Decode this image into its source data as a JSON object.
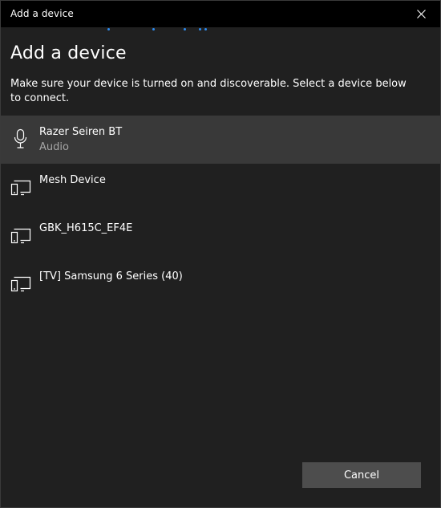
{
  "window": {
    "title": "Add a device",
    "close_icon": "close-icon"
  },
  "progress": {
    "color": "#2e8cf0",
    "indeterminate": true
  },
  "content": {
    "heading": "Add a device",
    "description": "Make sure your device is turned on and discoverable. Select a device below to connect."
  },
  "devices": [
    {
      "name": "Razer Seiren BT",
      "type": "Audio",
      "icon": "microphone-icon",
      "selected": true
    },
    {
      "name": "Mesh Device",
      "type": "",
      "icon": "display-device-icon",
      "selected": false
    },
    {
      "name": "GBK_H615C_EF4E",
      "type": "",
      "icon": "display-device-icon",
      "selected": false
    },
    {
      "name": "[TV] Samsung 6 Series (40)",
      "type": "",
      "icon": "display-device-icon",
      "selected": false
    }
  ],
  "footer": {
    "cancel_label": "Cancel"
  },
  "colors": {
    "background": "#202020",
    "titlebar": "#000000",
    "selected_row": "#393939",
    "secondary_text": "#a6a6a6",
    "button": "#4d4d4d"
  }
}
